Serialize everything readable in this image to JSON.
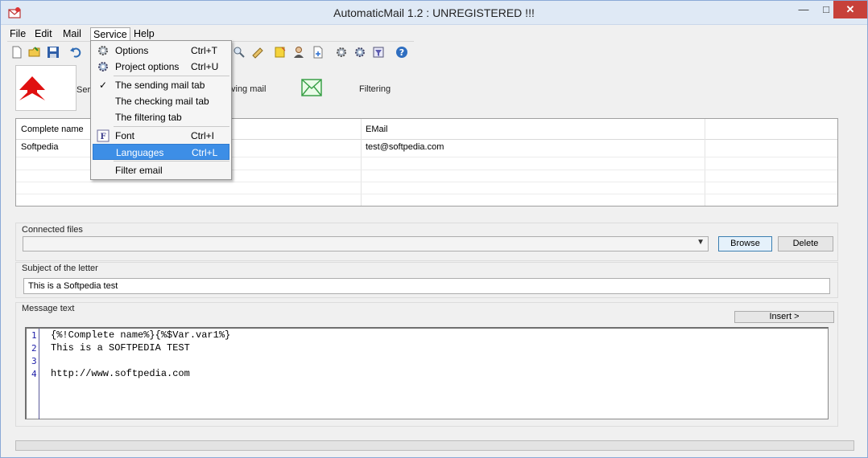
{
  "window": {
    "title": "AutomaticMail 1.2 : UNREGISTERED !!!"
  },
  "menubar": [
    {
      "label": "File"
    },
    {
      "label": "Edit"
    },
    {
      "label": "Mail"
    },
    {
      "label": "Service"
    },
    {
      "label": "Help"
    }
  ],
  "tabs": {
    "sending_partial": "Ser",
    "receiving_partial": "ving mail",
    "filtering": "Filtering"
  },
  "grid": {
    "columns": [
      "Complete name",
      "EMail"
    ],
    "rows": [
      {
        "name": "Softpedia",
        "email": "test@softpedia.com"
      }
    ]
  },
  "connected_files": {
    "label": "Connected files",
    "value": "",
    "browse": "Browse",
    "delete": "Delete"
  },
  "subject": {
    "label": "Subject of the letter",
    "value": "This is a Softpedia test"
  },
  "message": {
    "label": "Message text",
    "insert": "Insert >",
    "lines": [
      {
        "num": "1",
        "text": "{%!Complete name%}{%$Var.var1%}"
      },
      {
        "num": "2",
        "text": "This is a SOFTPEDIA TEST"
      },
      {
        "num": "3",
        "text": ""
      },
      {
        "num": "4",
        "text": "http://www.softpedia.com"
      }
    ]
  },
  "service_menu": {
    "options": {
      "label": "Options",
      "shortcut": "Ctrl+T"
    },
    "project_options": {
      "label": "Project options",
      "shortcut": "Ctrl+U"
    },
    "sending_tab": {
      "label": "The sending mail tab",
      "check": "✓"
    },
    "checking_tab": {
      "label": "The checking mail tab"
    },
    "filtering_tab": {
      "label": "The filtering tab"
    },
    "font": {
      "label": "Font",
      "shortcut": "Ctrl+I"
    },
    "languages": {
      "label": "Languages",
      "shortcut": "Ctrl+L"
    },
    "filter_email": {
      "label": "Filter email"
    }
  },
  "colors": {
    "highlight": "#3d8ee6",
    "close": "#c7413a",
    "titlebar": "#dfe9f5"
  },
  "icons": [
    "app-mail-icon",
    "new-icon",
    "open-icon",
    "save-icon",
    "undo-icon",
    "gear-icon",
    "shield-icon",
    "envelope-icon"
  ]
}
